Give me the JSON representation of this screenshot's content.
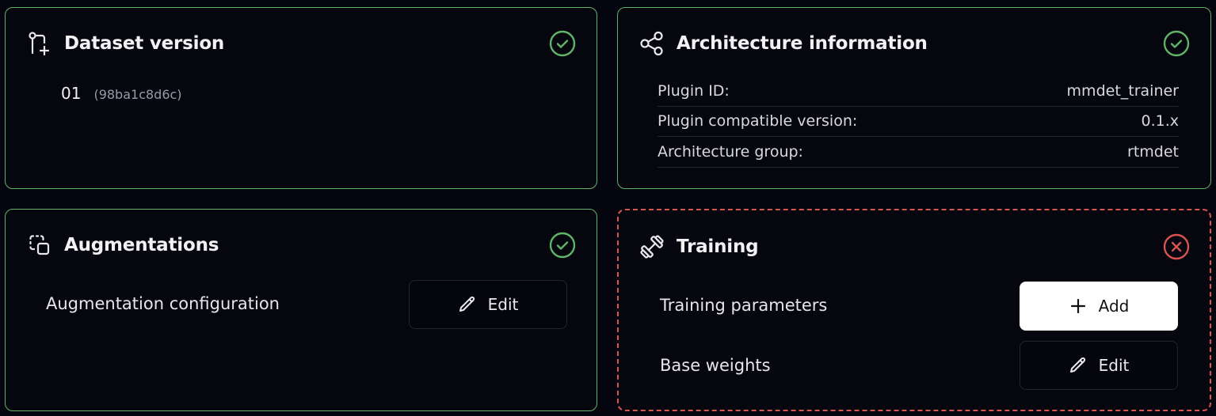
{
  "dataset": {
    "title": "Dataset version",
    "version": "01",
    "hash": "(98ba1c8d6c)",
    "status": "ok"
  },
  "architecture": {
    "title": "Architecture information",
    "status": "ok",
    "rows": [
      {
        "label": "Plugin ID:",
        "value": "mmdet_trainer"
      },
      {
        "label": "Plugin compatible version:",
        "value": "0.1.x"
      },
      {
        "label": "Architecture group:",
        "value": "rtmdet"
      }
    ]
  },
  "augmentations": {
    "title": "Augmentations",
    "status": "ok",
    "config_label": "Augmentation configuration",
    "edit_label": "Edit"
  },
  "training": {
    "title": "Training",
    "status": "error",
    "params_label": "Training parameters",
    "add_label": "Add",
    "weights_label": "Base weights",
    "edit_label": "Edit"
  },
  "colors": {
    "ok": "#5fb467",
    "error": "#d9534f",
    "background": "#050510"
  },
  "icons": {
    "dataset": "git-branch-icon",
    "architecture": "share-nodes-icon",
    "augmentations": "copy-squares-icon",
    "training": "dumbbell-icon",
    "ok": "check-circle-icon",
    "error": "x-circle-icon",
    "edit": "pencil-icon",
    "add": "plus-icon"
  }
}
